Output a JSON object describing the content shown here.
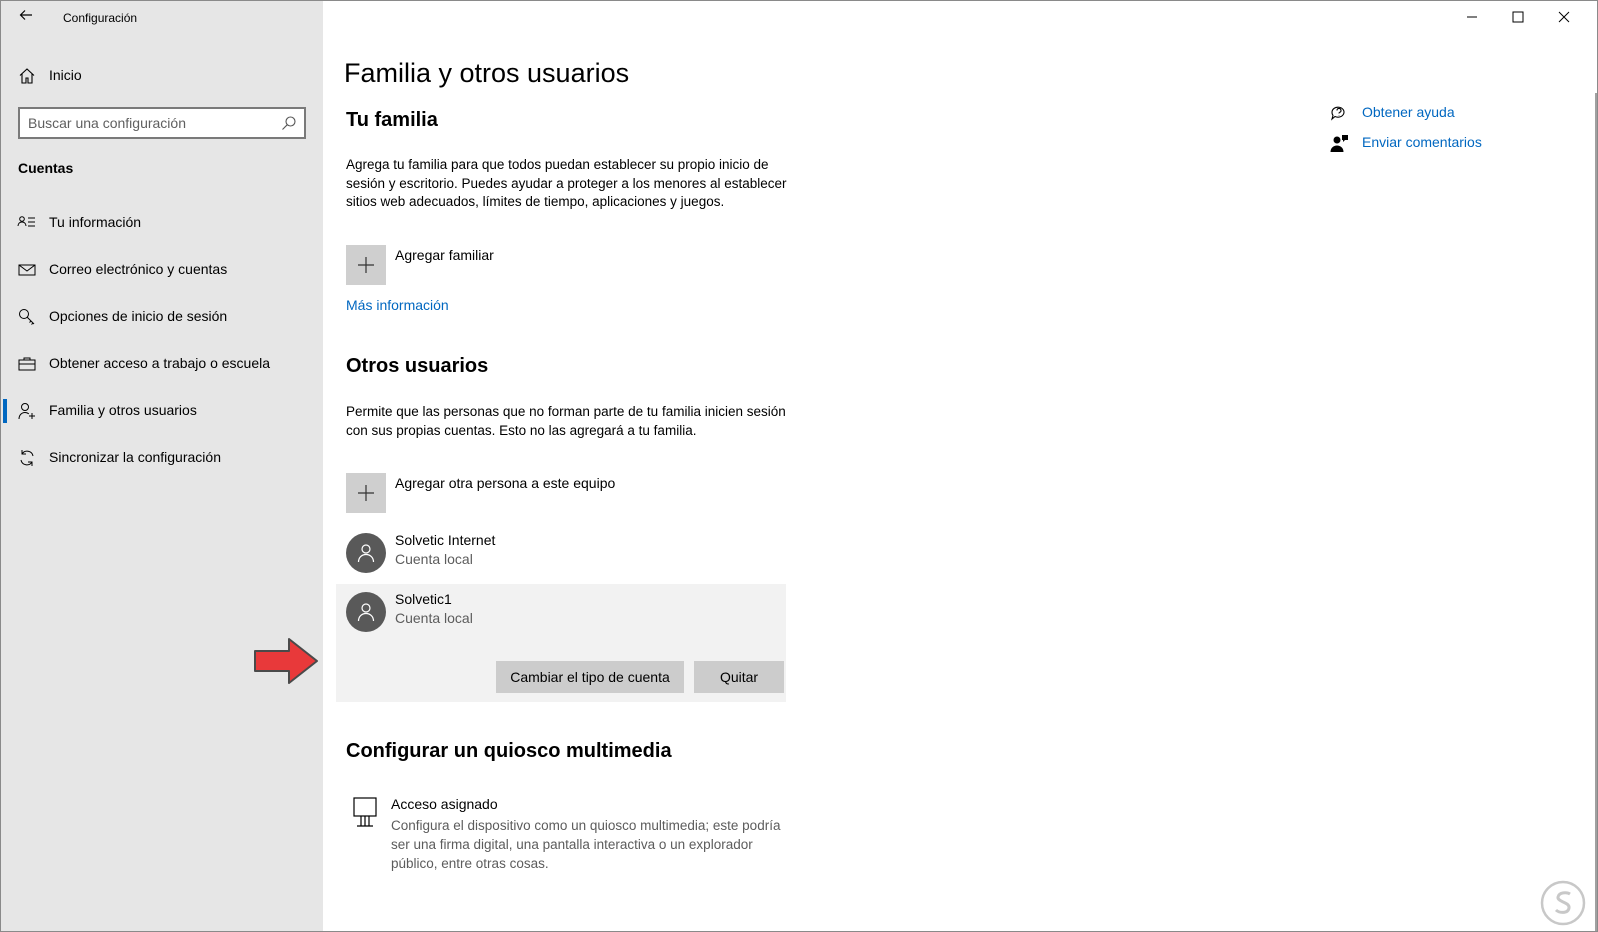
{
  "window": {
    "title": "Configuración",
    "back_icon": "back-arrow-icon",
    "controls": [
      "minimize-icon",
      "maximize-icon",
      "close-icon"
    ]
  },
  "sidebar": {
    "home_label": "Inicio",
    "search_placeholder": "Buscar una configuración",
    "section": "Cuentas",
    "items": [
      {
        "label": "Tu información",
        "icon": "contact-card-icon",
        "active": false
      },
      {
        "label": "Correo electrónico y cuentas",
        "icon": "mail-icon",
        "active": false
      },
      {
        "label": "Opciones de inicio de sesión",
        "icon": "key-icon",
        "active": false
      },
      {
        "label": "Obtener acceso a trabajo o escuela",
        "icon": "briefcase-icon",
        "active": false
      },
      {
        "label": "Familia y otros usuarios",
        "icon": "person-add-icon",
        "active": true
      },
      {
        "label": "Sincronizar la configuración",
        "icon": "sync-icon",
        "active": false
      }
    ],
    "accent_color": "#0067c0"
  },
  "main": {
    "page_title": "Familia y otros usuarios",
    "family": {
      "heading": "Tu familia",
      "description": "Agrega tu familia para que todos puedan establecer su propio inicio de sesión y escritorio. Puedes ayudar a proteger a los menores al establecer sitios web adecuados, límites de tiempo, aplicaciones y juegos.",
      "add_label": "Agregar familiar",
      "more_info": "Más información"
    },
    "others": {
      "heading": "Otros usuarios",
      "description": "Permite que las personas que no forman parte de tu familia inicien sesión con sus propias cuentas. Esto no las agregará a tu familia.",
      "add_label": "Agregar otra persona a este equipo",
      "users": [
        {
          "name": "Solvetic Internet",
          "type": "Cuenta local"
        },
        {
          "name": "Solvetic1",
          "type": "Cuenta local"
        }
      ],
      "change_type_button": "Cambiar el tipo de cuenta",
      "remove_button": "Quitar"
    },
    "kiosk": {
      "heading": "Configurar un quiosco multimedia",
      "title": "Acceso asignado",
      "description": "Configura el dispositivo como un quiosco multimedia; este podría ser una firma digital, una pantalla interactiva o un explorador público, entre otras cosas."
    },
    "help_links": [
      {
        "label": "Obtener ayuda",
        "icon": "help-chat-icon"
      },
      {
        "label": "Enviar comentarios",
        "icon": "feedback-icon"
      }
    ]
  },
  "annotation": {
    "arrow_color": "#e8393a",
    "icon": "red-arrow-icon"
  }
}
